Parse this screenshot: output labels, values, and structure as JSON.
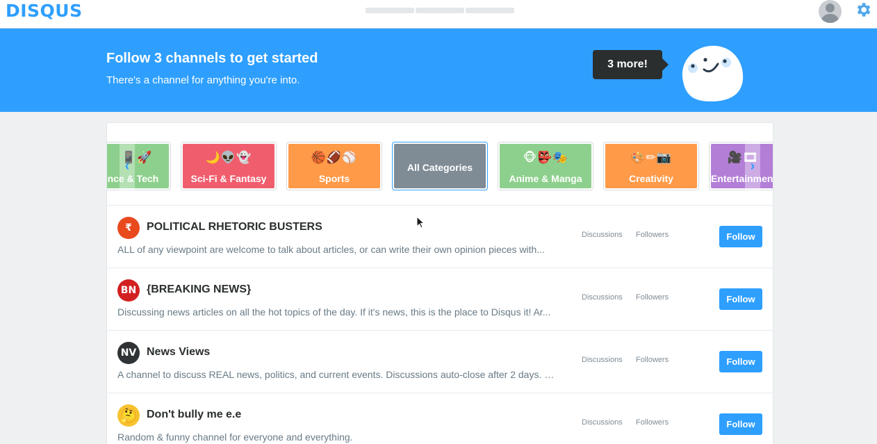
{
  "header": {
    "logo": "DISQUS",
    "icons": {
      "avatar": "user-avatar-icon",
      "settings": "gear-icon"
    }
  },
  "banner": {
    "title": "Follow 3 channels to get started",
    "subtitle": "There's a channel for anything you're into.",
    "bubble": "3 more!"
  },
  "categories": [
    {
      "label": "Science & Tech",
      "emoji": "📱🚀",
      "color": "#8dd08d"
    },
    {
      "label": "Sci-Fi & Fantasy",
      "emoji": "🌙👽👻",
      "color": "#f05e6e"
    },
    {
      "label": "Sports",
      "emoji": "🏀🏈⚾",
      "color": "#ff9a48"
    },
    {
      "label": "All Categories",
      "emoji": "",
      "color": "#7f8c96",
      "selected": true
    },
    {
      "label": "Anime & Manga",
      "emoji": "🐵👺🎭",
      "color": "#8dd08d"
    },
    {
      "label": "Creativity",
      "emoji": "🎨✏📷",
      "color": "#ff9a48"
    },
    {
      "label": "Entertainment",
      "emoji": "🎥🎞",
      "color": "#b27ed6"
    }
  ],
  "channels": [
    {
      "name": "POLITICAL RHETORIC BUSTERS",
      "description": "ALL of any viewpoint are welcome to talk about articles, or can write their own opinion pieces with...",
      "icon_text": "₹",
      "icon_color": "#e84a1e",
      "discussions_label": "Discussions",
      "followers_label": "Followers",
      "follow_label": "Follow"
    },
    {
      "name": "{BREAKING NEWS}",
      "description": "Discussing news articles on all the hot topics of the day. If it's news, this is the place to Disqus it! Ar...",
      "icon_text": "BN",
      "icon_color": "#d21f1f",
      "discussions_label": "Discussions",
      "followers_label": "Followers",
      "follow_label": "Follow"
    },
    {
      "name": "News Views",
      "description": "A channel to discuss REAL news, politics, and current events. Discussions auto-close after 2 days. D...",
      "icon_text": "NV",
      "icon_color": "#2f3335",
      "discussions_label": "Discussions",
      "followers_label": "Followers",
      "follow_label": "Follow"
    },
    {
      "name": "Don't bully me e.e",
      "description": "Random & funny channel for everyone and everything.",
      "icon_text": "🤔",
      "icon_color": "#f7c22f",
      "discussions_label": "Discussions",
      "followers_label": "Followers",
      "follow_label": "Follow"
    }
  ]
}
